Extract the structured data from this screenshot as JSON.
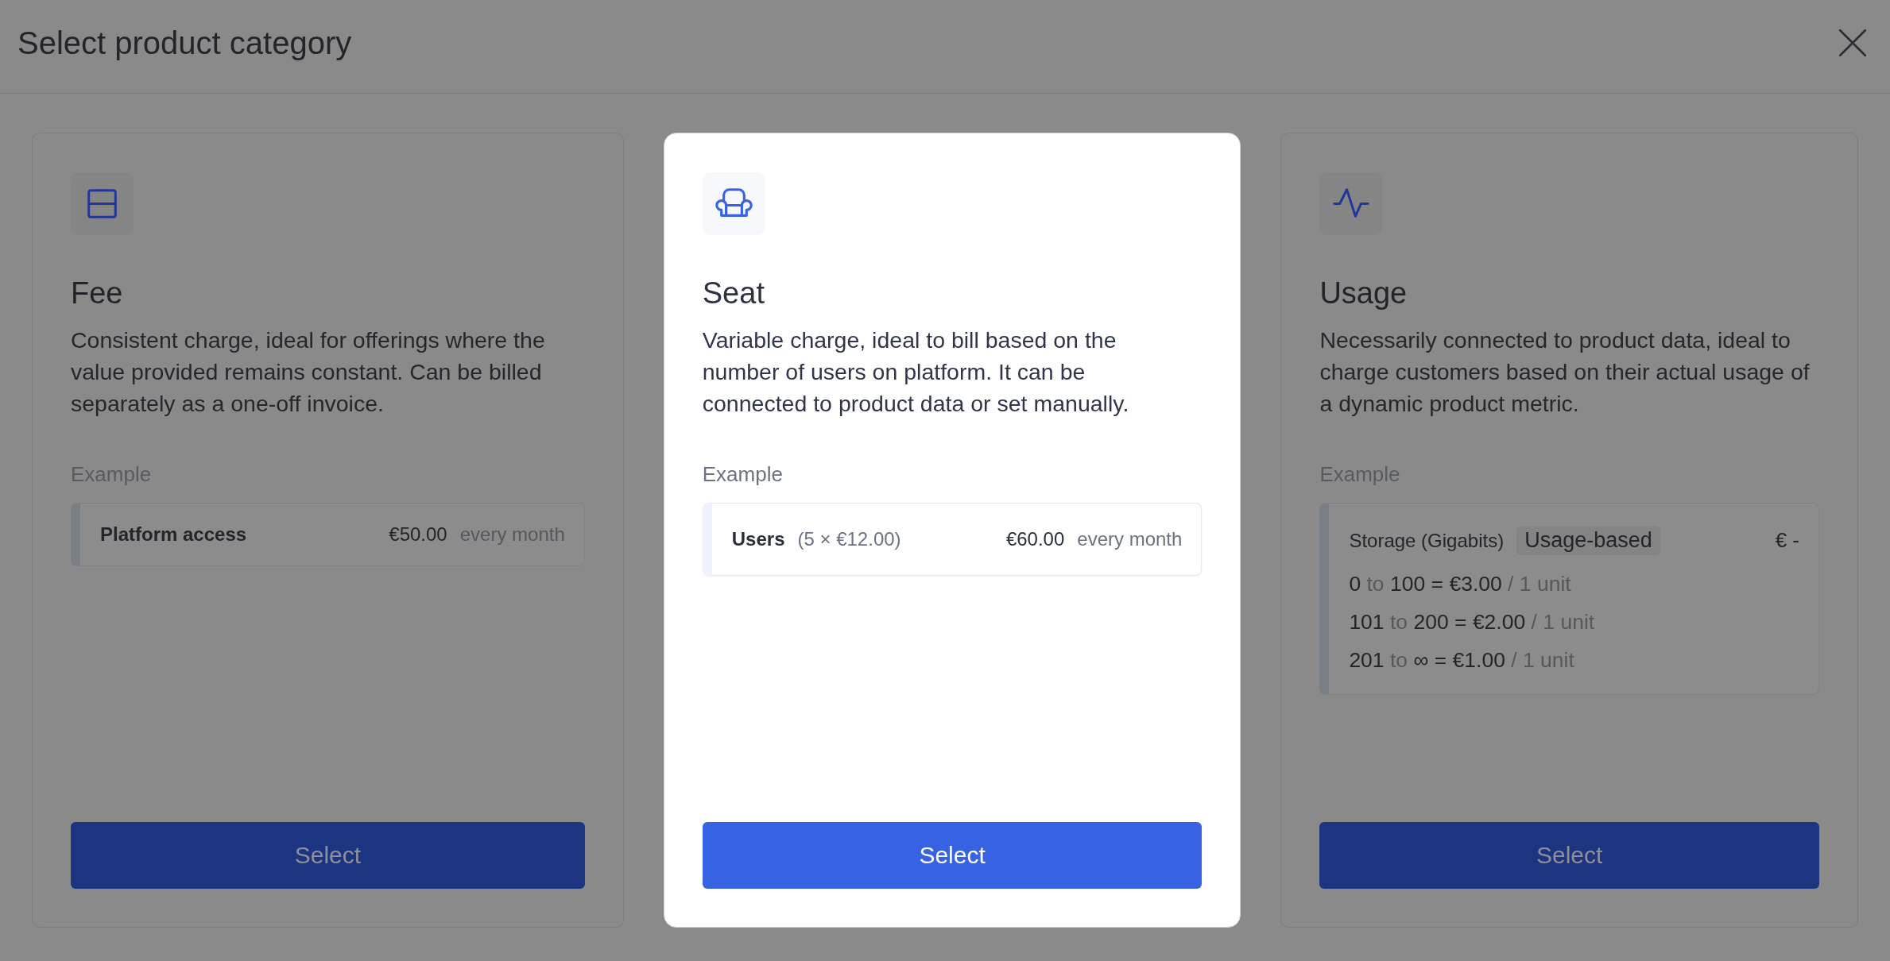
{
  "window": {
    "title": "Select product category"
  },
  "categories": [
    {
      "kind": "fee",
      "selected": false,
      "title": "Fee",
      "description": "Consistent charge, ideal for offerings where the value provided remains constant. Can be billed separately as a one-off invoice.",
      "example_label": "Example",
      "example": {
        "kind": "line",
        "name": "Platform access",
        "price": "€50.00",
        "period": "every month"
      },
      "button": "Select"
    },
    {
      "kind": "seat",
      "selected": true,
      "title": "Seat",
      "description": "Variable charge, ideal to bill based on the number of users on platform. It can be connected to product data or set manually.",
      "example_label": "Example",
      "example": {
        "kind": "line",
        "name": "Users",
        "detail": "(5 × €12.00)",
        "price": "€60.00",
        "period": "every month"
      },
      "button": "Select"
    },
    {
      "kind": "usage",
      "selected": false,
      "title": "Usage",
      "description": "Necessarily connected to product data, ideal to charge customers based on their actual usage of a dynamic product metric.",
      "example_label": "Example",
      "example": {
        "kind": "tiers",
        "name": "Storage (Gigabits)",
        "badge": "Usage-based",
        "price": "€ -",
        "tiers": [
          {
            "from": "0",
            "word": "to",
            "to": "100",
            "price": "= €3.00",
            "unit": "/ 1 unit"
          },
          {
            "from": "101",
            "word": "to",
            "to": "200",
            "price": "= €2.00",
            "unit": "/ 1 unit"
          },
          {
            "from": "201",
            "word": "to",
            "to": "∞",
            "price": "= €1.00",
            "unit": "/ 1 unit"
          }
        ]
      },
      "button": "Select"
    }
  ]
}
